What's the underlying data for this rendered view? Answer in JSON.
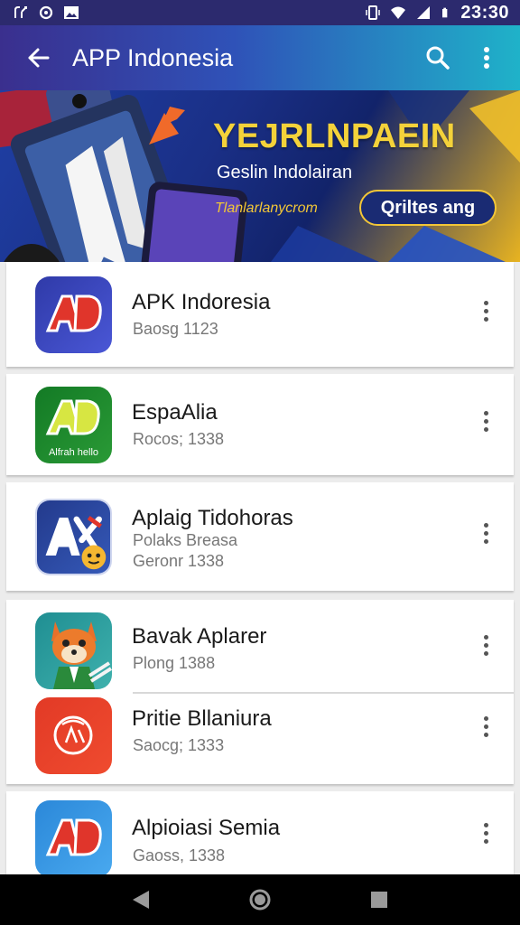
{
  "status_bar": {
    "time": "23:30",
    "left_icons": [
      "network-icon",
      "sync-icon",
      "image-icon"
    ],
    "right_icons": [
      "vibrate-icon",
      "wifi-icon",
      "signal-icon",
      "battery-icon"
    ]
  },
  "app_bar": {
    "title": "APP Indonesia",
    "back_icon": "arrow-left-icon",
    "search_icon": "search-icon",
    "menu_icon": "more-vert-icon"
  },
  "banner": {
    "title": "YEJRLNPAEIN",
    "subtitle": "Geslin Indolairan",
    "url": "Tlanlarlanycrom",
    "cta": "Qriltes ang"
  },
  "apps": [
    {
      "name": "APK Indoresia",
      "meta_lines": [
        "Baosg 1123"
      ],
      "icon": "apk-indoresia-icon",
      "icon_letters": "AD",
      "colors": [
        "#2f3aa8",
        "#4a57d6"
      ]
    },
    {
      "name": "EspaAlia",
      "meta_lines": [
        "Rocos; 1338"
      ],
      "icon": "espaalia-icon",
      "icon_letters": "AD",
      "icon_caption": "Alfrah hello",
      "colors": [
        "#137a25",
        "#2a9a36"
      ]
    },
    {
      "name": "Aplaig Tidohoras",
      "meta_lines": [
        "Polaks Breasa",
        "Geronr 1338"
      ],
      "icon": "aplaig-icon",
      "icon_letters": "AK",
      "colors": [
        "#233a8c",
        "#3559b8"
      ]
    },
    {
      "name": "Bavak Aplarer",
      "meta_lines": [
        "Plong 1388"
      ],
      "icon": "bavak-fox-icon",
      "colors": [
        "#1f8e92",
        "#3fb1ad"
      ]
    },
    {
      "name": "Pritie Bllaniura",
      "meta_lines": [
        "Saocg; 1333"
      ],
      "icon": "pritie-icon",
      "colors": [
        "#e23a26",
        "#ef4b2f"
      ]
    },
    {
      "name": "Alpioiasi Semia",
      "meta_lines": [
        "Gaoss, 1338"
      ],
      "icon": "alpioiasi-icon",
      "icon_letters": "AD",
      "colors": [
        "#2b88d9",
        "#49a9ef"
      ]
    }
  ],
  "nav_bar": {
    "back": "nav-back-icon",
    "home": "nav-home-icon",
    "recents": "nav-recents-icon"
  }
}
